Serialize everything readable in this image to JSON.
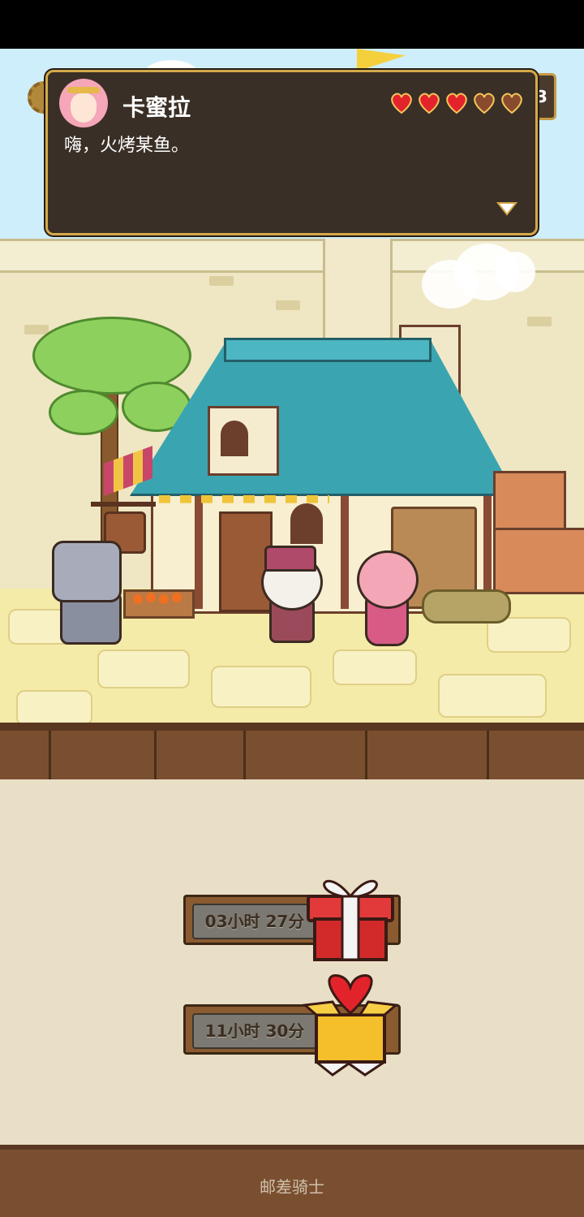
{
  "dialog": {
    "speaker": "卡蜜拉",
    "text": "嗨，火烤某鱼。",
    "affection_hearts": [
      true,
      true,
      true,
      false,
      false
    ]
  },
  "top_right_counter": "3",
  "timers": [
    {
      "label": "03小时 27分",
      "reward": "gift-box-icon"
    },
    {
      "label": "11小时 30分",
      "reward": "heart-box-icon"
    }
  ],
  "footer": {
    "label": "邮差骑士"
  },
  "colors": {
    "dialog_bg": "#3a2f26",
    "dialog_border": "#d4a94a",
    "heart_full": "#e3232b",
    "heart_empty": "#8a4a2e"
  }
}
